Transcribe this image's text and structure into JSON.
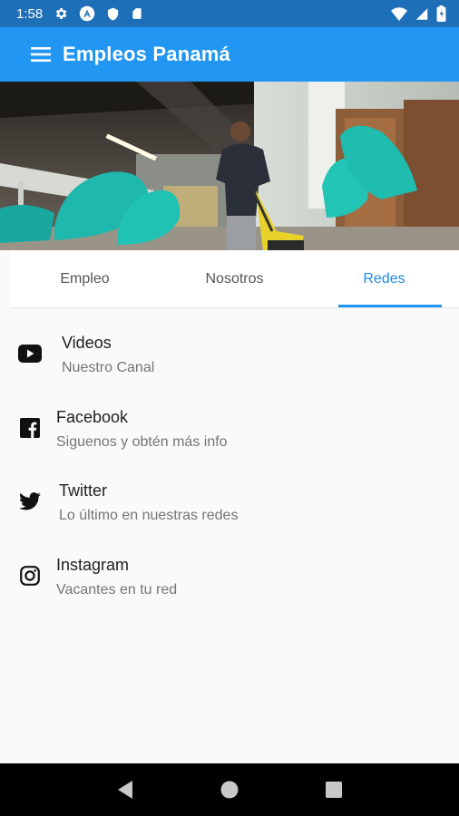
{
  "status": {
    "time": "1:58"
  },
  "appbar": {
    "title": "Empleos Panamá"
  },
  "tabs": [
    {
      "label": "Empleo",
      "active": false
    },
    {
      "label": "Nosotros",
      "active": false
    },
    {
      "label": "Redes",
      "active": true
    }
  ],
  "social": [
    {
      "title": "Videos",
      "subtitle": "Nuestro Canal",
      "icon": "youtube-icon"
    },
    {
      "title": "Facebook",
      "subtitle": "Siguenos y obtén más info",
      "icon": "facebook-icon"
    },
    {
      "title": "Twitter",
      "subtitle": "Lo último en nuestras redes",
      "icon": "twitter-icon"
    },
    {
      "title": "Instagram",
      "subtitle": "Vacantes en tu red",
      "icon": "instagram-icon"
    }
  ],
  "colors": {
    "primary": "#2196f3",
    "status_bar": "#1d6fb8",
    "accent": "#1e88e5"
  }
}
